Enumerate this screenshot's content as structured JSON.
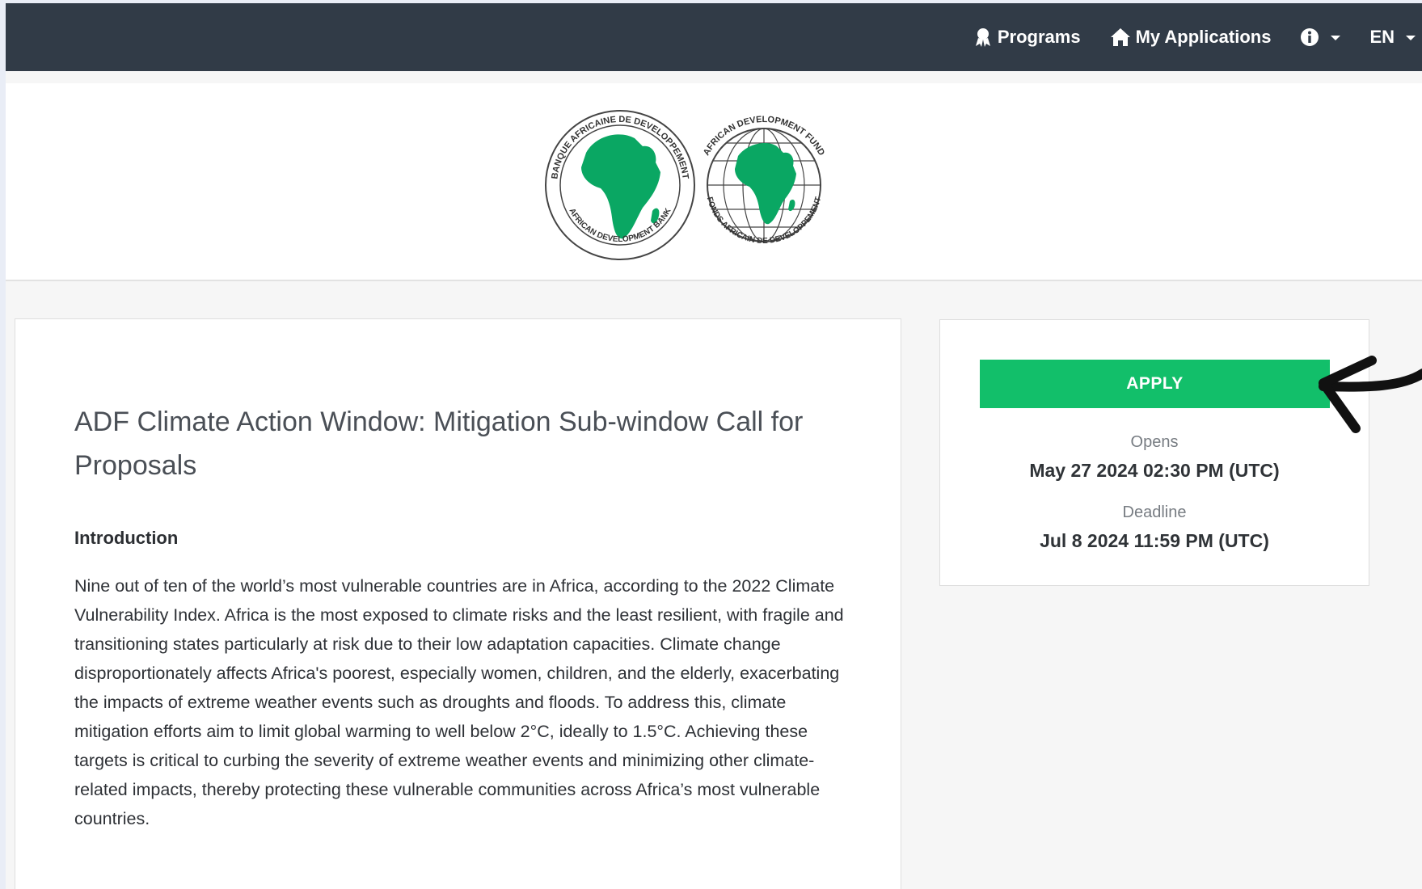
{
  "nav": {
    "programs_label": "Programs",
    "applications_label": "My Applications",
    "language_label": "EN",
    "icons": [
      "award-icon",
      "home-icon",
      "info-icon"
    ]
  },
  "logos": {
    "afdb_ring_text": "BANQUE AFRICAINE DE DEVELOPPEMENT",
    "afdb_bottom_text": "AFRICAN DEVELOPMENT BANK",
    "adf_top_text": "AFRICAN DEVELOPMENT FUND",
    "adf_bottom_text": "FONDS AFRICAIN DE DEVELOPPEMENT"
  },
  "program": {
    "title": "ADF Climate Action Window: Mitigation Sub-window Call for Proposals",
    "intro_heading": "Introduction",
    "intro_text": "Nine out of ten of the world’s most vulnerable countries are in Africa, according to the 2022 Climate Vulnerability Index. Africa is the most exposed to climate risks and the least resilient, with fragile and transitioning states particularly at risk due to their low adaptation capacities. Climate change disproportionately affects Africa's poorest, especially women, children, and the elderly, exacerbating the impacts of extreme weather events such as droughts and floods. To address this, climate mitigation efforts aim to limit global warming to well below 2°C, ideally to 1.5°C. Achieving these targets is critical to curbing the severity of extreme weather events and minimizing other climate-related impacts, thereby protecting these vulnerable communities across Africa’s most vulnerable countries."
  },
  "sidebar": {
    "apply_label": "APPLY",
    "opens_label": "Opens",
    "opens_value": "May 27 2024 02:30 PM (UTC)",
    "deadline_label": "Deadline",
    "deadline_value": "Jul 8 2024 11:59 PM (UTC)"
  },
  "colors": {
    "nav_bg": "#313b47",
    "accent_green": "#12bf6a",
    "logo_green": "#0aa763"
  }
}
